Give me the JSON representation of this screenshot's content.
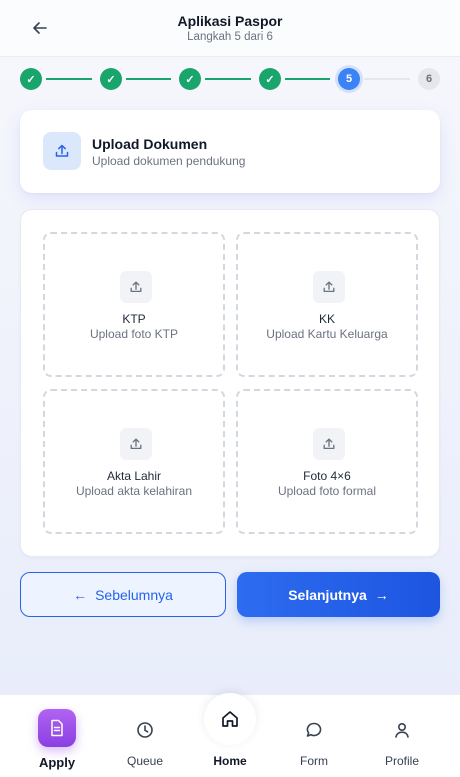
{
  "header": {
    "title": "Aplikasi Paspor",
    "subtitle": "Langkah 5 dari 6",
    "back_icon": "arrow-left-icon"
  },
  "stepper": {
    "current": 5,
    "total": 6,
    "steps": [
      {
        "label": "✓",
        "state": "done"
      },
      {
        "label": "✓",
        "state": "done"
      },
      {
        "label": "✓",
        "state": "done"
      },
      {
        "label": "✓",
        "state": "done"
      },
      {
        "label": "5",
        "state": "current"
      },
      {
        "label": "6",
        "state": "todo"
      }
    ]
  },
  "section": {
    "title": "Upload Dokumen",
    "description": "Upload dokumen pendukung",
    "icon": "upload-icon"
  },
  "documents": [
    {
      "label": "KTP",
      "hint": "Upload foto KTP"
    },
    {
      "label": "KK",
      "hint": "Upload Kartu Keluarga"
    },
    {
      "label": "Akta Lahir",
      "hint": "Upload akta kelahiran"
    },
    {
      "label": "Foto 4×6",
      "hint": "Upload foto formal"
    }
  ],
  "buttons": {
    "prev_arrow": "←",
    "prev_label": "Sebelumnya",
    "next_label": "Selanjutnya",
    "next_arrow": "→"
  },
  "bottom_nav": {
    "items": [
      {
        "label": "Apply",
        "icon": "document-icon",
        "active": true
      },
      {
        "label": "Queue",
        "icon": "clock-icon"
      },
      {
        "label": "Home",
        "icon": "home-icon"
      },
      {
        "label": "Form",
        "icon": "chat-bubble-icon"
      },
      {
        "label": "Profile",
        "icon": "user-icon"
      }
    ]
  },
  "colors": {
    "done": "#1aa56d",
    "current": "#3b82f6",
    "primary": "#2563eb",
    "apply_accent": "#9b4ee8"
  }
}
